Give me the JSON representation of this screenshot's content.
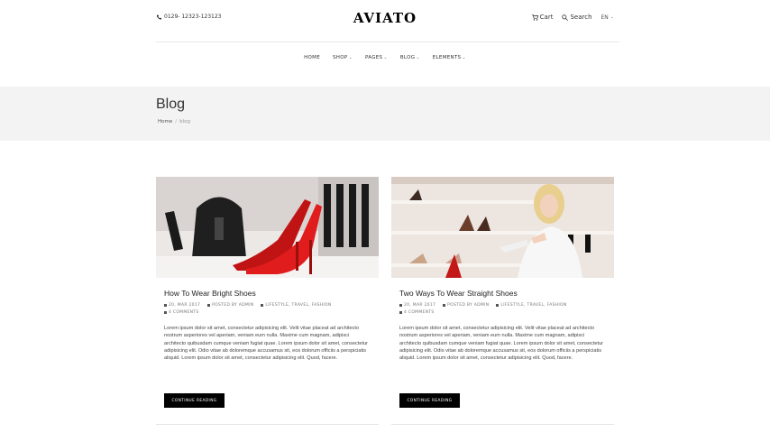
{
  "header": {
    "phone": "0129- 12323-123123",
    "logo": "AVIATO",
    "cart_label": "Cart",
    "search_label": "Search",
    "language": "EN"
  },
  "nav": {
    "items": [
      {
        "label": "HOME",
        "has_dropdown": false
      },
      {
        "label": "SHOP",
        "has_dropdown": true
      },
      {
        "label": "PAGES",
        "has_dropdown": true
      },
      {
        "label": "BLOG",
        "has_dropdown": true
      },
      {
        "label": "ELEMENTS",
        "has_dropdown": true
      }
    ]
  },
  "page_header": {
    "title": "Blog",
    "breadcrumb": {
      "home": "Home",
      "separator": "/",
      "current": "blog"
    }
  },
  "posts": [
    {
      "title": "How To Wear Bright Shoes",
      "date": "20, MAR 2017",
      "author": "POSTED BY ADMIN",
      "tags": "LIFESTYLE, TRAVEL, FASHION",
      "comments": "4 COMMENTS",
      "excerpt": "Lorem ipsum dolor sit amet, consectetur adipisicing elit. Velit vitae placeat ad architecto nostrum asperiores vel aperiam, veniam eum nulla. Maxime cum magnam, adipisci architecto quibusdam cumque veniam fugiat quae. Lorem ipsum dolor sit amet, consectetur adipisicing elit. Odio vitae ab doloremque accusamus sit, eos dolorum officiis a perspiciatis aliquid. Lorem ipsum dolor sit amet, consectetur adipisicing elit. Quod, facere.",
      "button": "CONTINUE READING"
    },
    {
      "title": "Two Ways To Wear Straight Shoes",
      "date": "20, MAR 2017",
      "author": "POSTED BY ADMIN",
      "tags": "LIFESTYLE, TRAVEL, FASHION",
      "comments": "4 COMMENTS",
      "excerpt": "Lorem ipsum dolor sit amet, consectetur adipisicing elit. Velit vitae placeat ad architecto nostrum asperiores vel aperiam, veniam eum nulla. Maxime cum magnam, adipisci architecto quibusdam cumque veniam fugiat quae. Lorem ipsum dolor sit amet, consectetur adipisicing elit. Odio vitae ab doloremque accusamus sit, eos dolorum officiis a perspiciatis aliquid. Lorem ipsum dolor sit amet, consectetur adipisicing elit. Quod, facere.",
      "button": "CONTINUE READING"
    }
  ]
}
